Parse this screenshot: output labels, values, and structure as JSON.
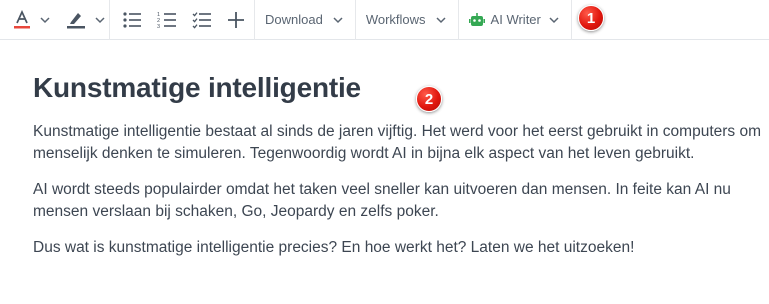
{
  "toolbar": {
    "download_label": "Download",
    "workflows_label": "Workflows",
    "ai_writer_label": "AI Writer"
  },
  "markers": {
    "m1": "1",
    "m2": "2"
  },
  "document": {
    "title": "Kunstmatige intelligentie",
    "paragraphs": [
      "Kunstmatige intelligentie bestaat al sinds de jaren vijftig. Het werd voor het eerst gebruikt in computers om menselijk denken te simuleren. Tegenwoordig wordt AI in bijna elk aspect van het leven gebruikt.",
      "AI wordt steeds populairder omdat het taken veel sneller kan uitvoeren dan mensen. In feite kan AI nu mensen verslaan bij schaken, Go, Jeopardy en zelfs poker.",
      "Dus wat is kunstmatige intelligentie precies? En hoe werkt het? Laten we het uitzoeken!"
    ]
  },
  "colors": {
    "highlight_bar": "#4a5562",
    "text_color_bar": "#e8473c",
    "ai_icon": "#34a853",
    "marker": "#e1170e"
  },
  "icons": [
    "text-color-icon",
    "highlight-icon",
    "bullet-list-icon",
    "numbered-list-icon",
    "checklist-icon",
    "plus-icon",
    "chevron-down-icon",
    "robot-icon"
  ]
}
